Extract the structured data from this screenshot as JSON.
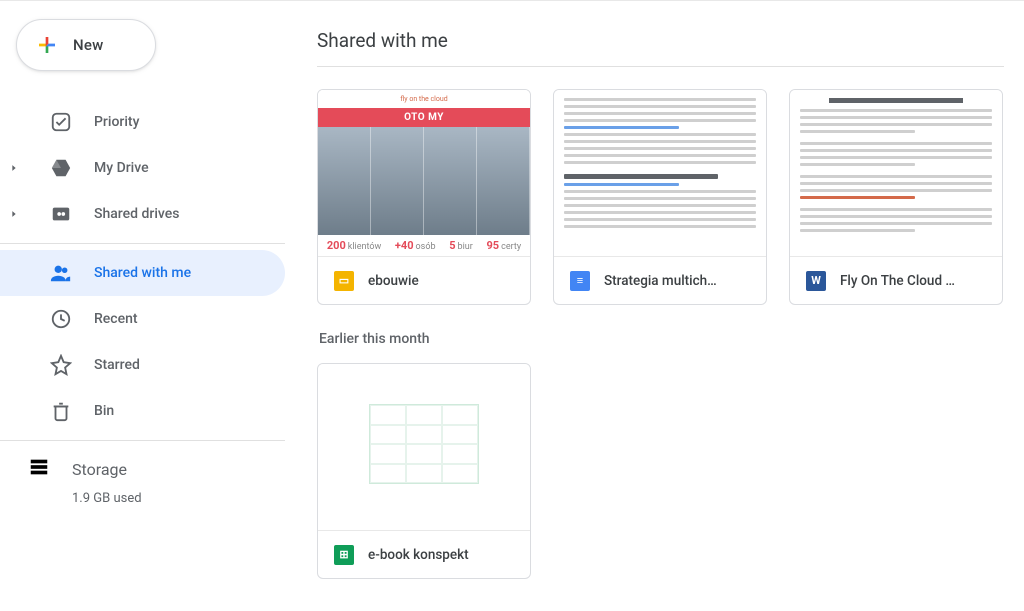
{
  "sidebar": {
    "new_label": "New",
    "items": [
      {
        "label": "Priority",
        "name": "priority",
        "icon": "priority",
        "caret": false,
        "selected": false
      },
      {
        "label": "My Drive",
        "name": "my-drive",
        "icon": "drive",
        "caret": true,
        "selected": false
      },
      {
        "label": "Shared drives",
        "name": "shared-drives",
        "icon": "shared-dr",
        "caret": true,
        "selected": false
      },
      {
        "label": "Shared with me",
        "name": "shared-with-me",
        "icon": "people",
        "caret": false,
        "selected": true
      },
      {
        "label": "Recent",
        "name": "recent",
        "icon": "clock",
        "caret": false,
        "selected": false
      },
      {
        "label": "Starred",
        "name": "starred",
        "icon": "star",
        "caret": false,
        "selected": false
      },
      {
        "label": "Bin",
        "name": "bin",
        "icon": "trash",
        "caret": false,
        "selected": false
      }
    ],
    "storage_label": "Storage",
    "storage_used": "1.9 GB used"
  },
  "main": {
    "title": "Shared with me",
    "section_label": "Earlier this month",
    "recent_files": [
      {
        "name": "ebouwie",
        "type": "slides",
        "type_glyph": "▭",
        "thumb": "slide"
      },
      {
        "name": "Strategia multich…",
        "type": "docs",
        "type_glyph": "≡",
        "thumb": "doc1"
      },
      {
        "name": "Fly On The Cloud …",
        "type": "word",
        "type_glyph": "W",
        "thumb": "doc2"
      }
    ],
    "earlier_files": [
      {
        "name": "e-book konspekt",
        "type": "sheets",
        "type_glyph": "⊞",
        "thumb": "blank"
      }
    ],
    "slide_thumb": {
      "brand": "fly on the cloud",
      "pill": "OTO MY",
      "stats": [
        {
          "num": "200",
          "cap": "klientów"
        },
        {
          "num": "+40",
          "cap": "osób"
        },
        {
          "num": "5",
          "cap": "biur"
        },
        {
          "num": "95",
          "cap": "certy"
        }
      ]
    }
  }
}
